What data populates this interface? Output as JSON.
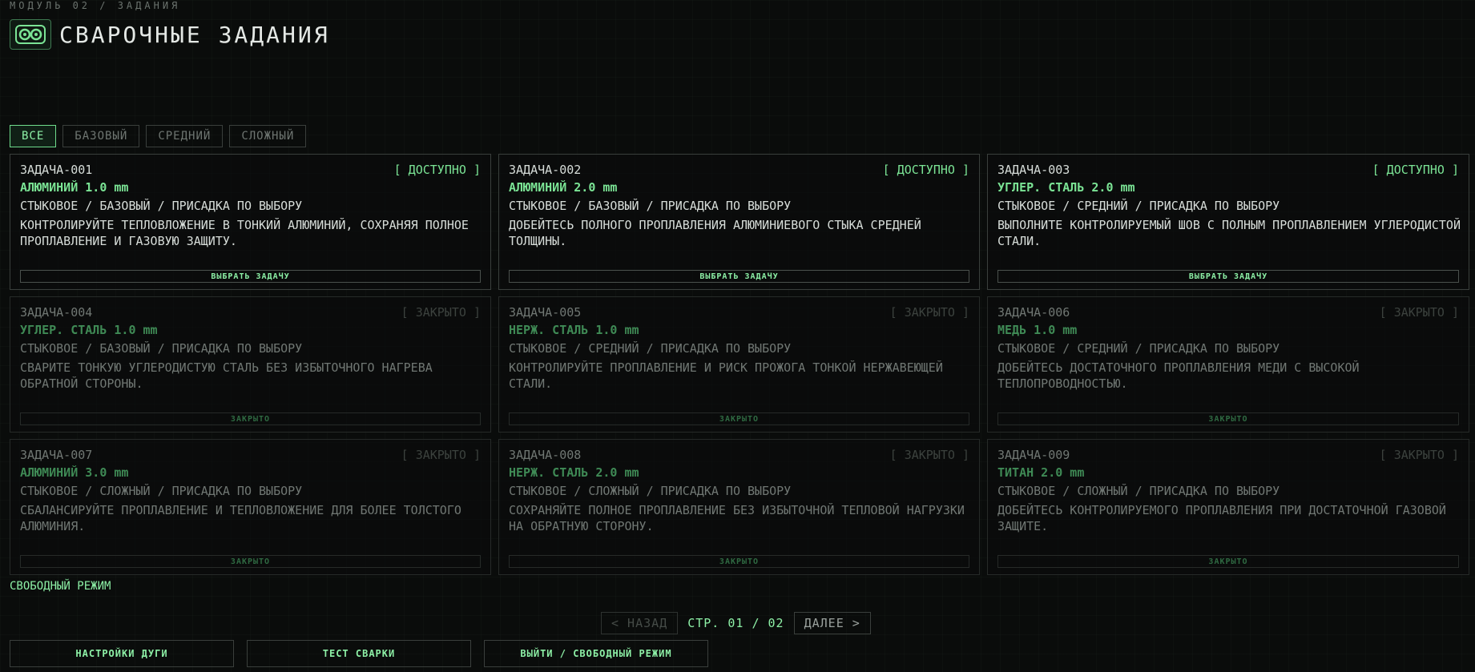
{
  "breadcrumb": "МОДУЛЬ 02 / ЗАДАНИЯ",
  "title": "СВАРОЧНЫЕ ЗАДАНИЯ",
  "logo_icon": "welding-mask-icon",
  "accent_color": "#7be495",
  "filters": [
    {
      "label": "ВСЕ",
      "active": true
    },
    {
      "label": "БАЗОВЫЙ",
      "active": false
    },
    {
      "label": "СРЕДНИЙ",
      "active": false
    },
    {
      "label": "СЛОЖНЫЙ",
      "active": false
    }
  ],
  "tasks": [
    {
      "id": "ЗАДАЧА-001",
      "status": "[ ДОСТУПНО ]",
      "locked": false,
      "material": "АЛЮМИНИЙ 1.0 mm",
      "meta": "СТЫКОВОЕ / БАЗОВЫЙ / ПРИСАДКА ПО ВЫБОРУ",
      "desc": "КОНТРОЛИРУЙТЕ ТЕПЛОВЛОЖЕНИЕ В ТОНКИЙ АЛЮМИНИЙ, СОХРАНЯЯ ПОЛНОЕ ПРОПЛАВЛЕНИЕ И ГАЗОВУЮ ЗАЩИТУ.",
      "action": "ВЫБРАТЬ ЗАДАЧУ"
    },
    {
      "id": "ЗАДАЧА-002",
      "status": "[ ДОСТУПНО ]",
      "locked": false,
      "material": "АЛЮМИНИЙ 2.0 mm",
      "meta": "СТЫКОВОЕ / БАЗОВЫЙ / ПРИСАДКА ПО ВЫБОРУ",
      "desc": "ДОБЕЙТЕСЬ ПОЛНОГО ПРОПЛАВЛЕНИЯ АЛЮМИНИЕВОГО СТЫКА СРЕДНЕЙ ТОЛЩИНЫ.",
      "action": "ВЫБРАТЬ ЗАДАЧУ"
    },
    {
      "id": "ЗАДАЧА-003",
      "status": "[ ДОСТУПНО ]",
      "locked": false,
      "material": "УГЛЕР. СТАЛЬ 2.0 mm",
      "meta": "СТЫКОВОЕ / СРЕДНИЙ / ПРИСАДКА ПО ВЫБОРУ",
      "desc": "ВЫПОЛНИТЕ КОНТРОЛИРУЕМЫЙ ШОВ С ПОЛНЫМ ПРОПЛАВЛЕНИЕМ УГЛЕРОДИСТОЙ СТАЛИ.",
      "action": "ВЫБРАТЬ ЗАДАЧУ"
    },
    {
      "id": "ЗАДАЧА-004",
      "status": "[ ЗАКРЫТО ]",
      "locked": true,
      "material": "УГЛЕР. СТАЛЬ 1.0 mm",
      "meta": "СТЫКОВОЕ / БАЗОВЫЙ / ПРИСАДКА ПО ВЫБОРУ",
      "desc": "СВАРИТЕ ТОНКУЮ УГЛЕРОДИСТУЮ СТАЛЬ БЕЗ ИЗБЫТОЧНОГО НАГРЕВА ОБРАТНОЙ СТОРОНЫ.",
      "action": "ЗАКРЫТО"
    },
    {
      "id": "ЗАДАЧА-005",
      "status": "[ ЗАКРЫТО ]",
      "locked": true,
      "material": "НЕРЖ. СТАЛЬ 1.0 mm",
      "meta": "СТЫКОВОЕ / СРЕДНИЙ / ПРИСАДКА ПО ВЫБОРУ",
      "desc": "КОНТРОЛИРУЙТЕ ПРОПЛАВЛЕНИЕ И РИСК ПРОЖОГА ТОНКОЙ НЕРЖАВЕЮЩЕЙ СТАЛИ.",
      "action": "ЗАКРЫТО"
    },
    {
      "id": "ЗАДАЧА-006",
      "status": "[ ЗАКРЫТО ]",
      "locked": true,
      "material": "МЕДЬ 1.0 mm",
      "meta": "СТЫКОВОЕ / СРЕДНИЙ / ПРИСАДКА ПО ВЫБОРУ",
      "desc": "ДОБЕЙТЕСЬ ДОСТАТОЧНОГО ПРОПЛАВЛЕНИЯ МЕДИ С ВЫСОКОЙ ТЕПЛОПРОВОДНОСТЬЮ.",
      "action": "ЗАКРЫТО"
    },
    {
      "id": "ЗАДАЧА-007",
      "status": "[ ЗАКРЫТО ]",
      "locked": true,
      "material": "АЛЮМИНИЙ 3.0 mm",
      "meta": "СТЫКОВОЕ / СЛОЖНЫЙ / ПРИСАДКА ПО ВЫБОРУ",
      "desc": "СБАЛАНСИРУЙТЕ ПРОПЛАВЛЕНИЕ И ТЕПЛОВЛОЖЕНИЕ ДЛЯ БОЛЕЕ ТОЛСТОГО АЛЮМИНИЯ.",
      "action": "ЗАКРЫТО"
    },
    {
      "id": "ЗАДАЧА-008",
      "status": "[ ЗАКРЫТО ]",
      "locked": true,
      "material": "НЕРЖ. СТАЛЬ 2.0 mm",
      "meta": "СТЫКОВОЕ / СЛОЖНЫЙ / ПРИСАДКА ПО ВЫБОРУ",
      "desc": "СОХРАНЯЙТЕ ПОЛНОЕ ПРОПЛАВЛЕНИЕ БЕЗ ИЗБЫТОЧНОЙ ТЕПЛОВОЙ НАГРУЗКИ НА ОБРАТНУЮ СТОРОНУ.",
      "action": "ЗАКРЫТО"
    },
    {
      "id": "ЗАДАЧА-009",
      "status": "[ ЗАКРЫТО ]",
      "locked": true,
      "material": "ТИТАН 2.0 mm",
      "meta": "СТЫКОВОЕ / СЛОЖНЫЙ / ПРИСАДКА ПО ВЫБОРУ",
      "desc": "ДОБЕЙТЕСЬ КОНТРОЛИРУЕМОГО ПРОПЛАВЛЕНИЯ ПРИ ДОСТАТОЧНОЙ ГАЗОВОЙ ЗАЩИТЕ.",
      "action": "ЗАКРЫТО"
    }
  ],
  "free_mode_link": "СВОБОДНЫЙ РЕЖИМ",
  "pager": {
    "prev": "< НАЗАД",
    "indicator": "СТР. 01 / 02",
    "next": "ДАЛЕЕ >"
  },
  "bottom_buttons": [
    "НАСТРОЙКИ ДУГИ",
    "ТЕСТ СВАРКИ",
    "ВЫЙТИ / СВОБОДНЫЙ РЕЖИМ"
  ]
}
